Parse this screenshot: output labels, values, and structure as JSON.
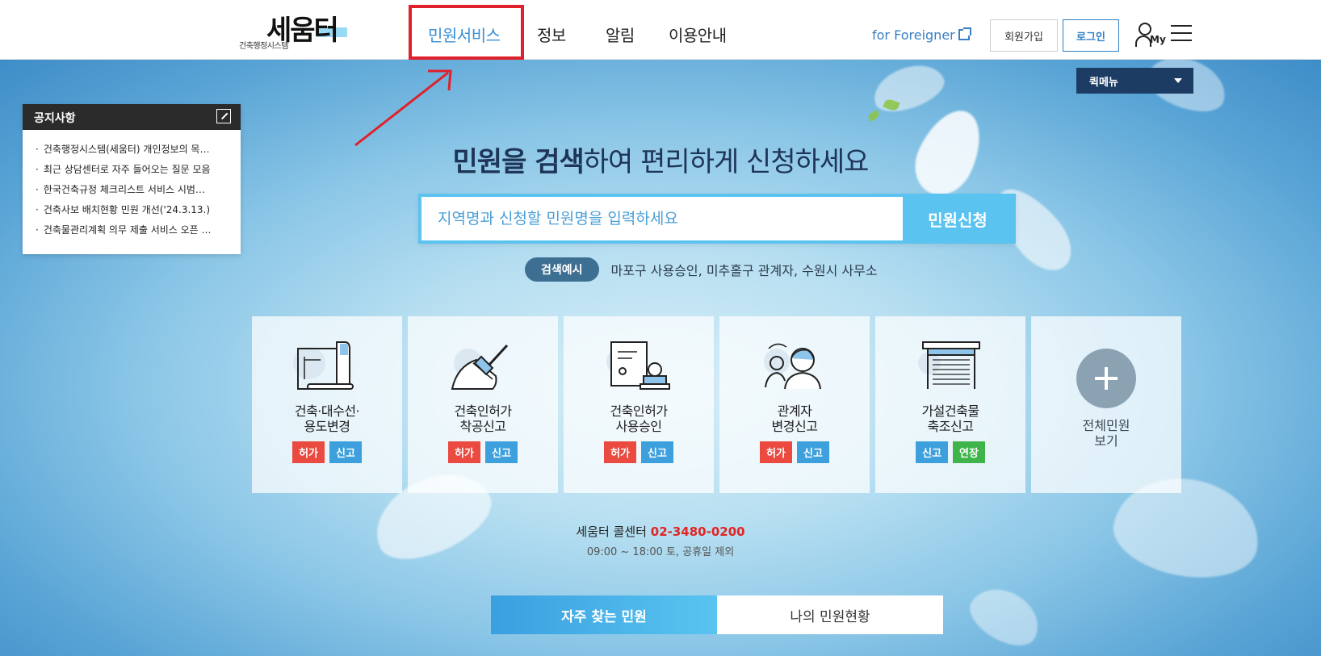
{
  "header": {
    "logo_text": "세움터",
    "logo_subtitle": "건축행정시스템",
    "nav": [
      {
        "label": "민원서비스"
      },
      {
        "label": "정보"
      },
      {
        "label": "알림"
      },
      {
        "label": "이용안내"
      }
    ],
    "foreigner_label": "for Foreigner",
    "join_label": "회원가입",
    "login_label": "로그인",
    "my_label": "My"
  },
  "quick_menu": {
    "label": "퀵메뉴"
  },
  "notice": {
    "title": "공지사항",
    "items": [
      "건축행정시스템(세움터) 개인정보의 목…",
      "최근 상담센터로 자주 들어오는 질문 모음",
      "한국건축규정 체크리스트 서비스 시범…",
      "건축사보 배치현황 민원 개선('24.3.13.)",
      "건축물관리계획 의무 제출 서비스 오픈 …"
    ]
  },
  "hero": {
    "headline_bold": "민원을 검색",
    "headline_rest": "하여 편리하게 신청하세요",
    "search_placeholder": "지역명과 신청할 민원명을 입력하세요",
    "search_button": "민원신청",
    "example_badge": "검색예시",
    "example_text": "마포구 사용승인, 미추홀구 관계자, 수원시 사무소"
  },
  "cards": [
    {
      "title_line1": "건축·대수선·",
      "title_line2": "용도변경",
      "tags": [
        {
          "label": "허가",
          "color": "#ea4a3f"
        },
        {
          "label": "신고",
          "color": "#3da0dd"
        }
      ],
      "icon": "blueprint-icon"
    },
    {
      "title_line1": "건축인허가",
      "title_line2": "착공신고",
      "tags": [
        {
          "label": "허가",
          "color": "#ea4a3f"
        },
        {
          "label": "신고",
          "color": "#3da0dd"
        }
      ],
      "icon": "trowel-icon"
    },
    {
      "title_line1": "건축인허가",
      "title_line2": "사용승인",
      "tags": [
        {
          "label": "허가",
          "color": "#ea4a3f"
        },
        {
          "label": "신고",
          "color": "#3da0dd"
        }
      ],
      "icon": "stamp-document-icon"
    },
    {
      "title_line1": "관계자",
      "title_line2": "변경신고",
      "tags": [
        {
          "label": "허가",
          "color": "#ea4a3f"
        },
        {
          "label": "신고",
          "color": "#3da0dd"
        }
      ],
      "icon": "people-change-icon"
    },
    {
      "title_line1": "가설건축물",
      "title_line2": "축조신고",
      "tags": [
        {
          "label": "신고",
          "color": "#3da0dd"
        },
        {
          "label": "연장",
          "color": "#3fb44a"
        }
      ],
      "icon": "temporary-building-icon"
    }
  ],
  "all_services": {
    "line1": "전체민원",
    "line2": "보기"
  },
  "call_center": {
    "label": "세움터 콜센터",
    "number": "02-3480-0200",
    "hours": "09:00 ~ 18:00 토, 공휴일 제외"
  },
  "tabs": [
    {
      "label": "자주 찾는 민원",
      "active": true
    },
    {
      "label": "나의 민원현황",
      "active": false
    }
  ],
  "colors": {
    "accent_blue": "#3a8fd4",
    "search_blue": "#5bc3ef",
    "annotation_red": "#e0202a",
    "quick_menu_navy": "#1d3c63",
    "call_number_red": "#e02424"
  }
}
